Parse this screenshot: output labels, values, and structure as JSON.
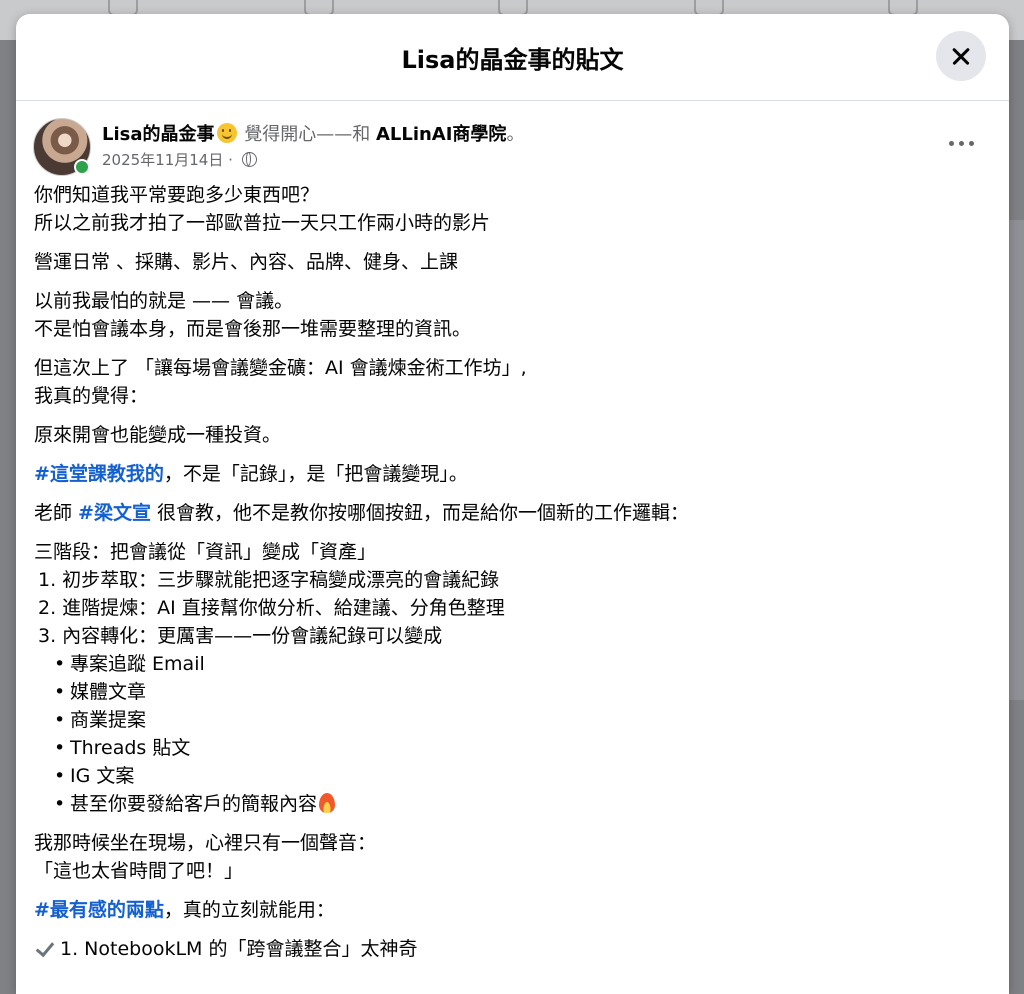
{
  "modal": {
    "title": "Lisa的晶金事的貼文",
    "close_icon": "close-icon"
  },
  "post": {
    "author": "Lisa的晶金事",
    "feeling_text": " 覺得開心——和 ",
    "tagged": "ALLinAI商學院",
    "tail": "。",
    "date": "2025年11月14日",
    "separator": " · ",
    "privacy_icon": "globe-icon",
    "more_icon": "more-options-icon",
    "body": {
      "p1_l1": "你們知道我平常要跑多少東西吧？",
      "p1_l2": "所以之前我才拍了一部歐普拉一天只工作兩小時的影片",
      "p2": "營運日常 、採購、影片、內容、品牌、健身、上課",
      "p3_l1": "以前我最怕的就是 —— 會議。",
      "p3_l2": "不是怕會議本身，而是會後那一堆需要整理的資訊。",
      "p4_l1": "但這次上了 「讓每場會議變金礦：AI 會議煉金術工作坊」,",
      "p4_l2": "我真的覺得：",
      "p5": "原來開會也能變成一種投資。",
      "p6_tag": "#這堂課教我的",
      "p6_text": "，不是「記錄」，是「把會議變現」。",
      "p7_pre": "老師 ",
      "p7_tag": "#梁文宣",
      "p7_text": " 很會教，他不是教你按哪個按鈕，而是給你一個新的工作邏輯：",
      "p8_head": "三階段：把會議從「資訊」變成「資產」",
      "steps": [
        "1. 初步萃取：三步驟就能把逐字稿變成漂亮的會議紀錄",
        "2. 進階提煉：AI 直接幫你做分析、給建議、分角色整理",
        "3. 內容轉化：更厲害——一份會議紀錄可以變成"
      ],
      "bullets": [
        "專案追蹤 Email",
        "媒體文章",
        "商業提案",
        "Threads 貼文",
        "IG 文案",
        "甚至你要發給客戶的簡報內容"
      ],
      "p9_l1": "我那時候坐在現場，心裡只有一個聲音：",
      "p9_l2": "「這也太省時間了吧！」",
      "p10_tag": "#最有感的兩點",
      "p10_text": "，真的立刻就能用：",
      "p11": "1. NotebookLM 的「跨會議整合」太神奇"
    }
  }
}
